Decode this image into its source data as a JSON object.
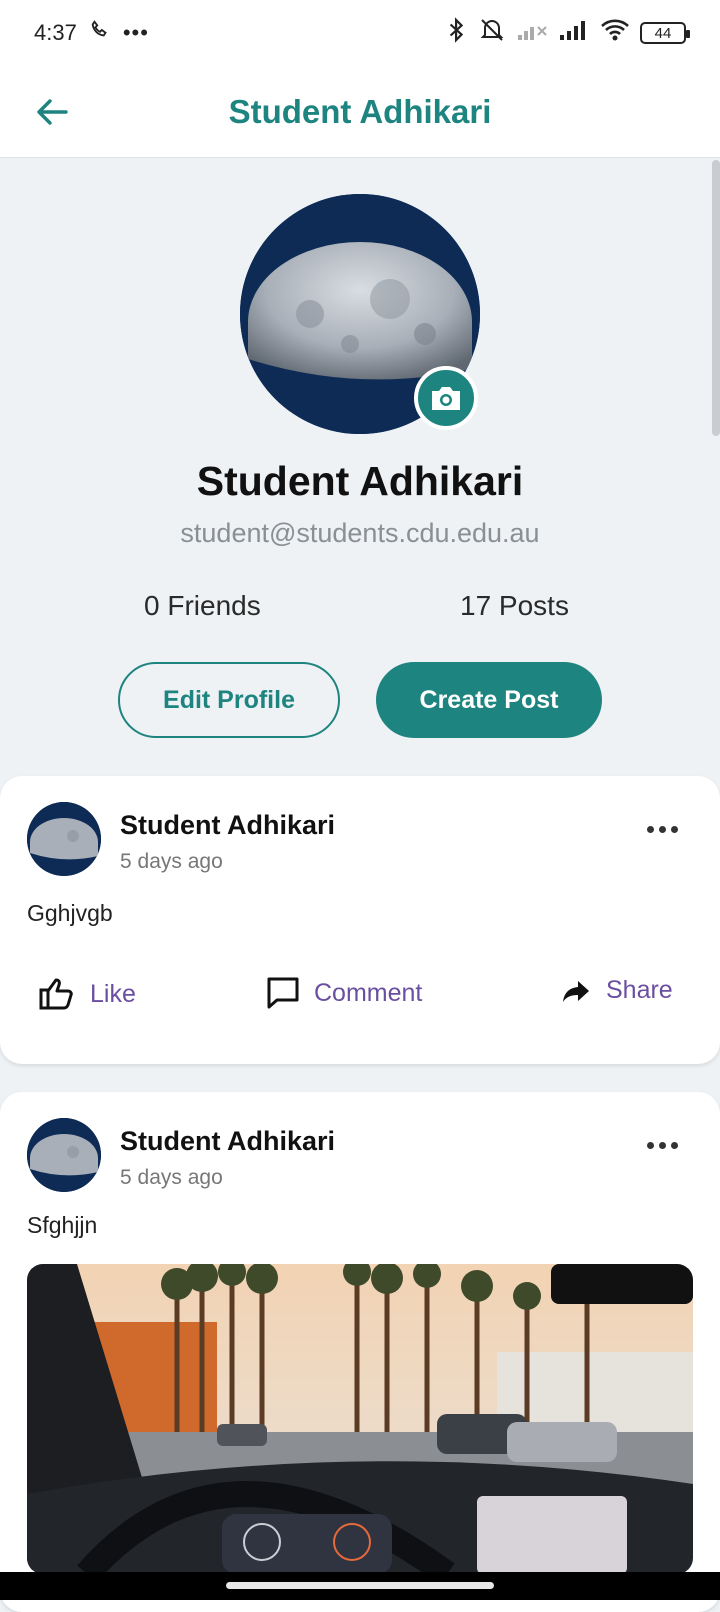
{
  "status_bar": {
    "time": "4:37",
    "battery": "44",
    "icons": [
      "wifi-calling-icon",
      "more-icon",
      "bluetooth-icon",
      "mute-icon",
      "no-signal-icon",
      "signal-icon",
      "wifi-icon",
      "battery-icon"
    ]
  },
  "app_bar": {
    "title": "Student Adhikari",
    "back_icon": "arrow-back-icon"
  },
  "profile": {
    "name": "Student Adhikari",
    "email": "student@students.cdu.edu.au",
    "friends": "0 Friends",
    "posts": "17 Posts",
    "edit_label": "Edit Profile",
    "create_label": "Create Post"
  },
  "posts": [
    {
      "author": "Student Adhikari",
      "time": "5 days ago",
      "text": "Gghjvgb",
      "like_label": "Like",
      "comment_label": "Comment",
      "share_label": "Share"
    },
    {
      "author": "Student Adhikari",
      "time": "5 days ago",
      "text": "Sfghjjn"
    }
  ],
  "colors": {
    "accent": "#1e8480",
    "action": "#6a4fa0",
    "background": "#eef2f5"
  }
}
